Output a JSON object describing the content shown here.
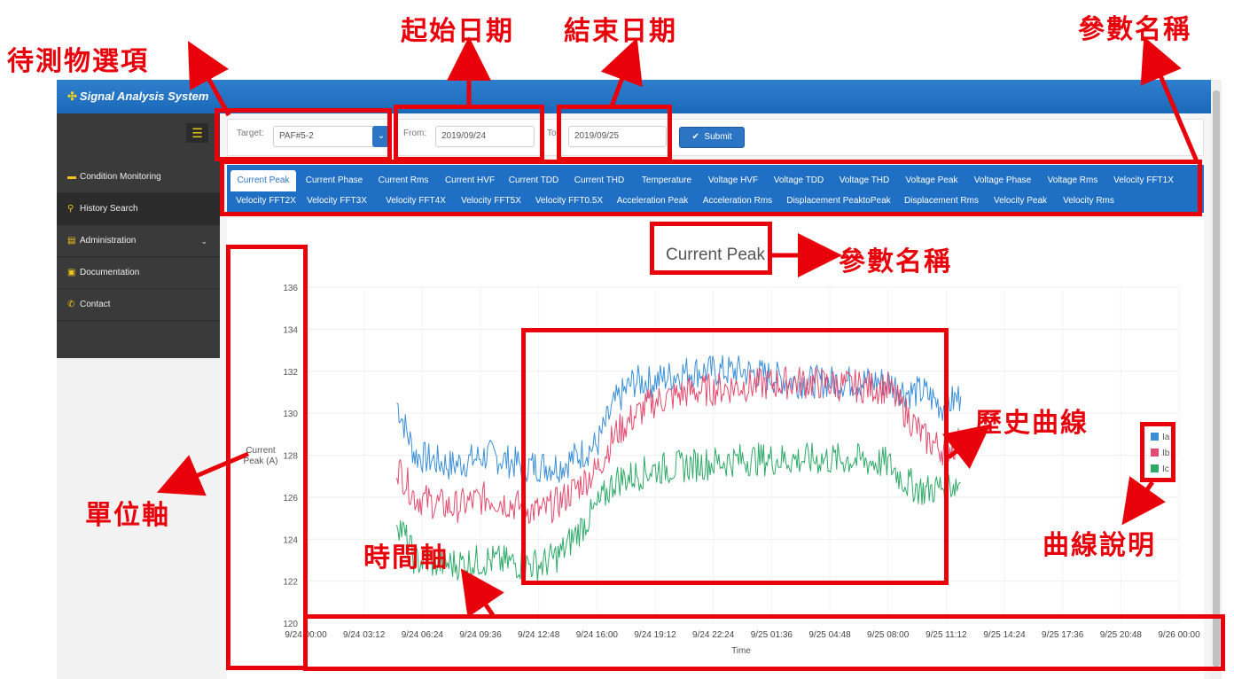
{
  "app": {
    "title": "Signal Analysis System"
  },
  "sidebar": {
    "items": [
      {
        "label": "Condition Monitoring",
        "icon": "monitor-icon"
      },
      {
        "label": "History Search",
        "icon": "search-icon",
        "active": true
      },
      {
        "label": "Administration",
        "icon": "admin-icon",
        "has_submenu": true
      },
      {
        "label": "Documentation",
        "icon": "document-icon"
      },
      {
        "label": "Contact",
        "icon": "phone-icon"
      }
    ]
  },
  "filter": {
    "target_label": "Target:",
    "target_value": "PAF#5-2",
    "from_label": "From:",
    "from_value": "2019/09/24",
    "to_label": "To:",
    "to_value": "2019/09/25",
    "submit_label": "Submit"
  },
  "tabs": {
    "row1": [
      "Current Peak",
      "Current Phase",
      "Current Rms",
      "Current HVF",
      "Current TDD",
      "Current THD",
      "Temperature",
      "Voltage HVF",
      "Voltage TDD",
      "Voltage THD",
      "Voltage Peak",
      "Voltage Phase",
      "Voltage Rms",
      "Velocity FFT1X"
    ],
    "row2": [
      "Velocity FFT2X",
      "Velocity FFT3X",
      "Velocity FFT4X",
      "Velocity FFT5X",
      "Velocity FFT0.5X",
      "Acceleration Peak",
      "Acceleration Rms",
      "Displacement PeaktoPeak",
      "Displacement Rms",
      "Velocity Peak",
      "Velocity Rms"
    ],
    "active": "Current Peak"
  },
  "chart_data": {
    "type": "line",
    "title": "Current Peak",
    "xlabel": "Time",
    "ylabel": "Current\nPeak (A)",
    "ylim": [
      120,
      136
    ],
    "y_ticks": [
      120,
      122,
      124,
      126,
      128,
      130,
      132,
      134,
      136
    ],
    "x_ticks": [
      "9/24 00:00",
      "9/24 03:12",
      "9/24 06:24",
      "9/24 09:36",
      "9/24 12:48",
      "9/24 16:00",
      "9/24 19:12",
      "9/24 22:24",
      "9/25 01:36",
      "9/25 04:48",
      "9/25 08:00",
      "9/25 11:12",
      "9/25 14:24",
      "9/25 17:36",
      "9/25 20:48",
      "9/26 00:00"
    ],
    "x_range": [
      "9/24 00:00",
      "9/26 00:00"
    ],
    "grid": true,
    "legend_position": "right",
    "series": [
      {
        "name": "Ia",
        "color": "#3b8fd6",
        "x": [
          "9/24 05:00",
          "9/24 06:00",
          "9/24 08:00",
          "9/24 10:00",
          "9/24 12:00",
          "9/24 13:00",
          "9/24 14:00",
          "9/24 16:00",
          "9/24 17:00",
          "9/24 18:00",
          "9/24 19:00",
          "9/24 21:00",
          "9/25 00:00",
          "9/25 03:00",
          "9/25 06:00",
          "9/25 08:00",
          "9/25 09:00",
          "9/25 10:00",
          "9/25 11:00",
          "9/25 12:00"
        ],
        "values": [
          130.5,
          128.0,
          127.5,
          128.0,
          127.5,
          127.5,
          127.5,
          128.5,
          130.5,
          131.5,
          131.5,
          132.0,
          132.0,
          131.5,
          131.5,
          131.5,
          131.0,
          131.0,
          130.3,
          130.8
        ]
      },
      {
        "name": "Ib",
        "color": "#e24a6e",
        "x": [
          "9/24 05:00",
          "9/24 06:00",
          "9/24 08:00",
          "9/24 10:00",
          "9/24 12:00",
          "9/24 13:00",
          "9/24 14:00",
          "9/24 16:00",
          "9/24 17:00",
          "9/24 18:00",
          "9/24 19:00",
          "9/24 21:00",
          "9/25 00:00",
          "9/25 03:00",
          "9/25 06:00",
          "9/25 08:00",
          "9/25 09:00",
          "9/25 10:00",
          "9/25 11:00",
          "9/25 12:00"
        ],
        "values": [
          127.5,
          126.0,
          125.5,
          126.0,
          125.5,
          125.3,
          125.8,
          127.3,
          129.0,
          129.8,
          130.5,
          131.0,
          131.3,
          131.5,
          131.3,
          131.2,
          130.0,
          128.8,
          128.3,
          128.6
        ]
      },
      {
        "name": "Ic",
        "color": "#2eaa68",
        "x": [
          "9/24 05:00",
          "9/24 06:00",
          "9/24 08:00",
          "9/24 10:00",
          "9/24 12:00",
          "9/24 13:00",
          "9/24 14:00",
          "9/24 16:00",
          "9/24 17:00",
          "9/24 18:00",
          "9/24 19:00",
          "9/24 21:00",
          "9/25 00:00",
          "9/25 03:00",
          "9/25 06:00",
          "9/25 08:00",
          "9/25 09:00",
          "9/25 10:00",
          "9/25 11:00",
          "9/25 12:00"
        ],
        "values": [
          125.0,
          123.0,
          122.8,
          123.0,
          122.8,
          122.8,
          123.3,
          125.5,
          126.8,
          127.0,
          127.3,
          127.5,
          127.8,
          127.8,
          127.8,
          127.6,
          126.7,
          126.3,
          126.5,
          126.7
        ]
      }
    ]
  },
  "annotations": {
    "target_option": "待測物選項",
    "start_date": "起始日期",
    "end_date": "結束日期",
    "param_name_top": "參數名稱",
    "param_name_chart": "參數名稱",
    "history_curve": "歷史曲線",
    "unit_axis": "單位軸",
    "time_axis": "時間軸",
    "legend_desc": "曲線說明",
    "color": "#e8000b"
  }
}
